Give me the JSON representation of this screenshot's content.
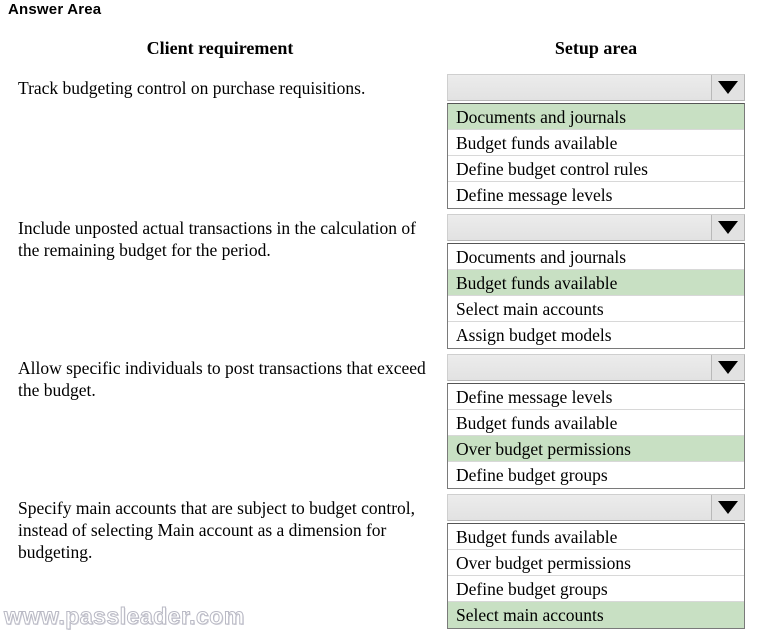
{
  "page": {
    "title": "Answer Area",
    "watermark": "www.passleader.com"
  },
  "colors": {
    "selected_option_bg": "#c8e0c3",
    "dropdown_header_bg": "#e6e6e6",
    "list_border": "#7a7a7a",
    "page_bg": "#ffffff",
    "text": "#000000"
  },
  "table": {
    "headers": {
      "client_requirement": "Client requirement",
      "setup_area": "Setup area"
    },
    "rows": [
      {
        "requirement": "Track budgeting control on purchase requisitions.",
        "dropdown": {
          "selected_value": "",
          "arrow_icon": "chevron-down-icon",
          "options": [
            {
              "label": "Documents and journals",
              "selected": true
            },
            {
              "label": "Budget funds available",
              "selected": false
            },
            {
              "label": "Define budget control rules",
              "selected": false
            },
            {
              "label": "Define message levels",
              "selected": false
            }
          ]
        }
      },
      {
        "requirement": "Include unposted actual transactions in the calculation of the remaining budget for the period.",
        "dropdown": {
          "selected_value": "",
          "arrow_icon": "chevron-down-icon",
          "options": [
            {
              "label": "Documents and journals",
              "selected": false
            },
            {
              "label": "Budget funds available",
              "selected": true
            },
            {
              "label": "Select main accounts",
              "selected": false
            },
            {
              "label": "Assign budget models",
              "selected": false
            }
          ]
        }
      },
      {
        "requirement": "Allow specific individuals to post transactions that exceed the budget.",
        "dropdown": {
          "selected_value": "",
          "arrow_icon": "chevron-down-icon",
          "options": [
            {
              "label": "Define message levels",
              "selected": false
            },
            {
              "label": "Budget funds available",
              "selected": false
            },
            {
              "label": "Over budget permissions",
              "selected": true
            },
            {
              "label": "Define budget groups",
              "selected": false
            }
          ]
        }
      },
      {
        "requirement": "Specify main accounts that are subject to budget control, instead of selecting Main account as a dimension for budgeting.",
        "dropdown": {
          "selected_value": "",
          "arrow_icon": "chevron-down-icon",
          "options": [
            {
              "label": "Budget funds available",
              "selected": false
            },
            {
              "label": "Over budget permissions",
              "selected": false
            },
            {
              "label": "Define budget groups",
              "selected": false
            },
            {
              "label": "Select main accounts",
              "selected": true
            }
          ]
        }
      }
    ]
  }
}
